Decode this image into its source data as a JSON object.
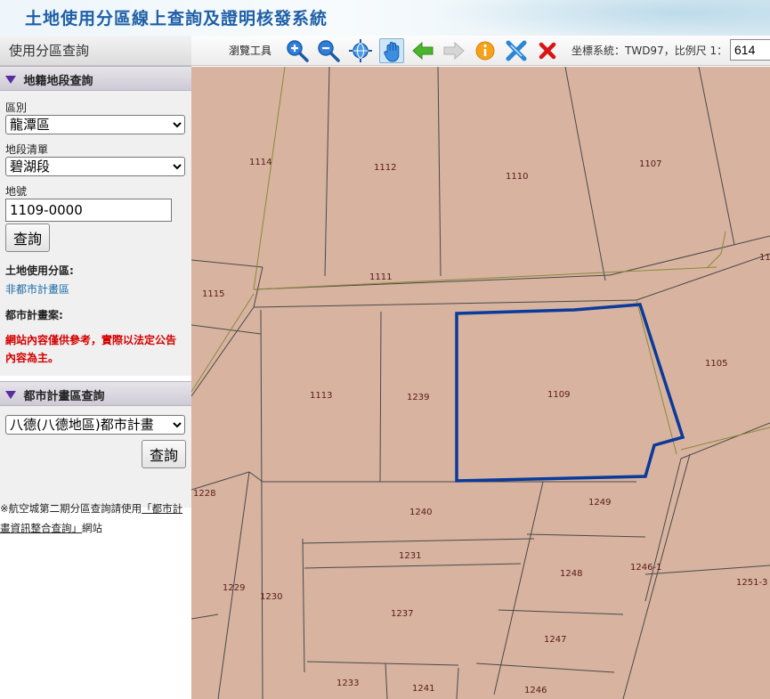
{
  "header": {
    "title": "土地使用分區線上查詢及證明核發系統"
  },
  "sidebar": {
    "title": "使用分區查詢",
    "land_panel": {
      "heading": "地籍地段查詢",
      "district_label": "區別",
      "district_value": "龍潭區",
      "section_label": "地段清單",
      "section_value": "碧湖段",
      "lot_label": "地號",
      "lot_value": "1109-0000",
      "query_button": "查詢",
      "zone_label": "土地使用分區:",
      "zone_value": "非都市計畫區",
      "plan_label": "都市計畫案:",
      "warning": "網站內容僅供參考，實際以法定公告內容為主。"
    },
    "plan_panel": {
      "heading": "都市計畫區查詢",
      "plan_value": "八德(八德地區)都市計畫",
      "query_button": "查詢"
    },
    "note": {
      "prefix": "※航空城第二期分區查詢請使用",
      "link": "「都市計畫資訊整合查詢」",
      "suffix": "網站"
    }
  },
  "toolbar": {
    "browse_label": "瀏覽工具",
    "tools": [
      "zoom-in-icon",
      "zoom-out-icon",
      "full-extent-icon",
      "pan-hand-icon",
      "back-arrow-icon",
      "forward-arrow-icon",
      "info-icon",
      "measure-icon",
      "clear-icon"
    ],
    "coord_label": "坐標系統：TWD97，比例尺 1：",
    "scale_value": "614"
  },
  "map": {
    "colors": {
      "parcel_fill": "#d7b3a0",
      "parcel_line": "#4a4a4a",
      "zone_line": "#8a8a3a",
      "highlight": "#0a3a9a"
    },
    "parcels": [
      "1114",
      "1112",
      "1110",
      "1107",
      "11",
      "1111",
      "1115",
      "1105",
      "1113",
      "1239",
      "1109",
      "1228",
      "1249",
      "1240",
      "1231",
      "1248",
      "1246-1",
      "1229",
      "1230",
      "1251-3",
      "1237",
      "1247",
      "1233",
      "1241",
      "1246"
    ],
    "selected_parcel": "1109"
  }
}
